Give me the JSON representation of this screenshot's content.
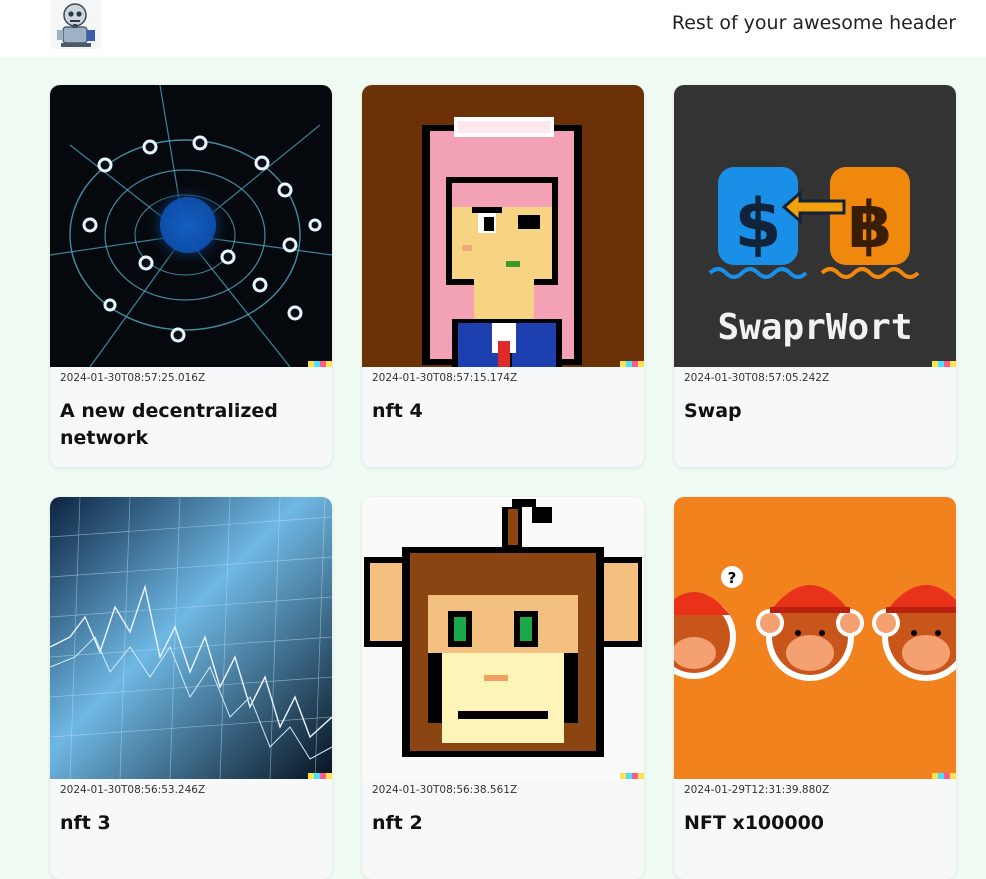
{
  "header": {
    "text": "Rest of your awesome header",
    "logo_icon": "robot-logo-icon"
  },
  "posts": [
    {
      "timestamp": "2024-01-30T08:57:25.016Z",
      "title": "A new decentralized network",
      "image": "network-globe-image"
    },
    {
      "timestamp": "2024-01-30T08:57:15.174Z",
      "title": "nft 4",
      "image": "pixel-anime-girl-image"
    },
    {
      "timestamp": "2024-01-30T08:57:05.242Z",
      "title": "Swap",
      "image": "swaprwort-logo-image",
      "image_text": "SwaprWort"
    },
    {
      "timestamp": "2024-01-30T08:56:53.246Z",
      "title": "nft 3",
      "image": "stock-chart-image"
    },
    {
      "timestamp": "2024-01-30T08:56:38.561Z",
      "title": "nft 2",
      "image": "pixel-monkey-image"
    },
    {
      "timestamp": "2024-01-29T12:31:39.880Z",
      "title": "NFT x100000",
      "image": "cartoon-monkeys-image"
    }
  ],
  "colors": {
    "page_background": "#f0fbf3",
    "card_background": "#f7f8fa"
  }
}
